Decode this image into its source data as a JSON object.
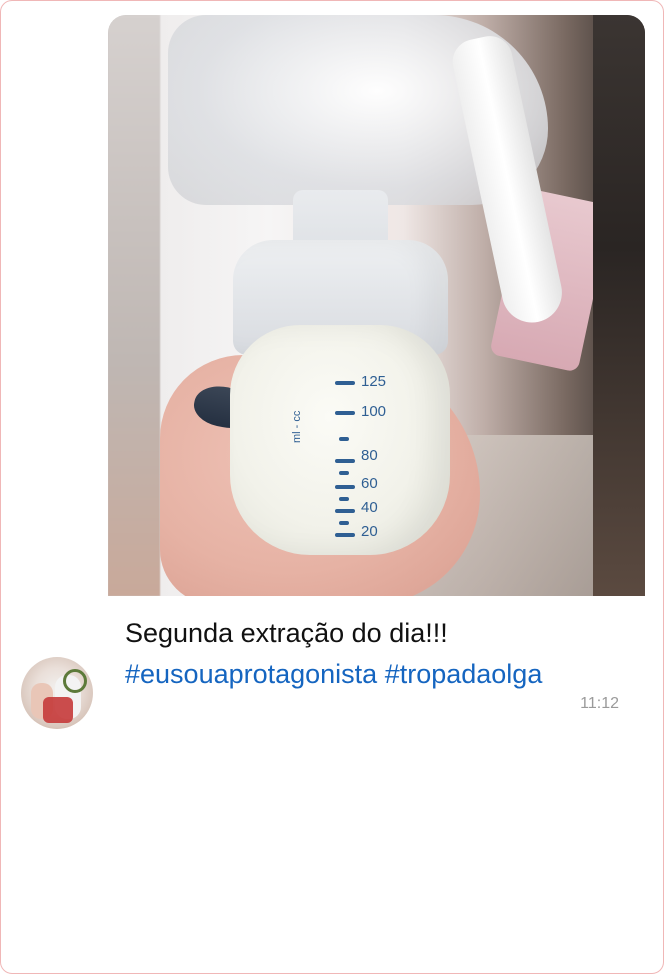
{
  "message": {
    "caption_line": "Segunda extração do dia!!!",
    "hashtags": "#eusouaprotagonista #tropadaolga",
    "time": "11:12"
  },
  "bottle_scale": {
    "unit": "ml - cc",
    "marks": [
      "125",
      "100",
      "80",
      "60",
      "40",
      "20"
    ]
  },
  "colors": {
    "hashtag": "#1565c0",
    "frame_border": "#f0b7b7",
    "scale": "#2f5f93",
    "time": "#9a9a9a"
  },
  "icons": {
    "avatar": "contact-avatar"
  }
}
